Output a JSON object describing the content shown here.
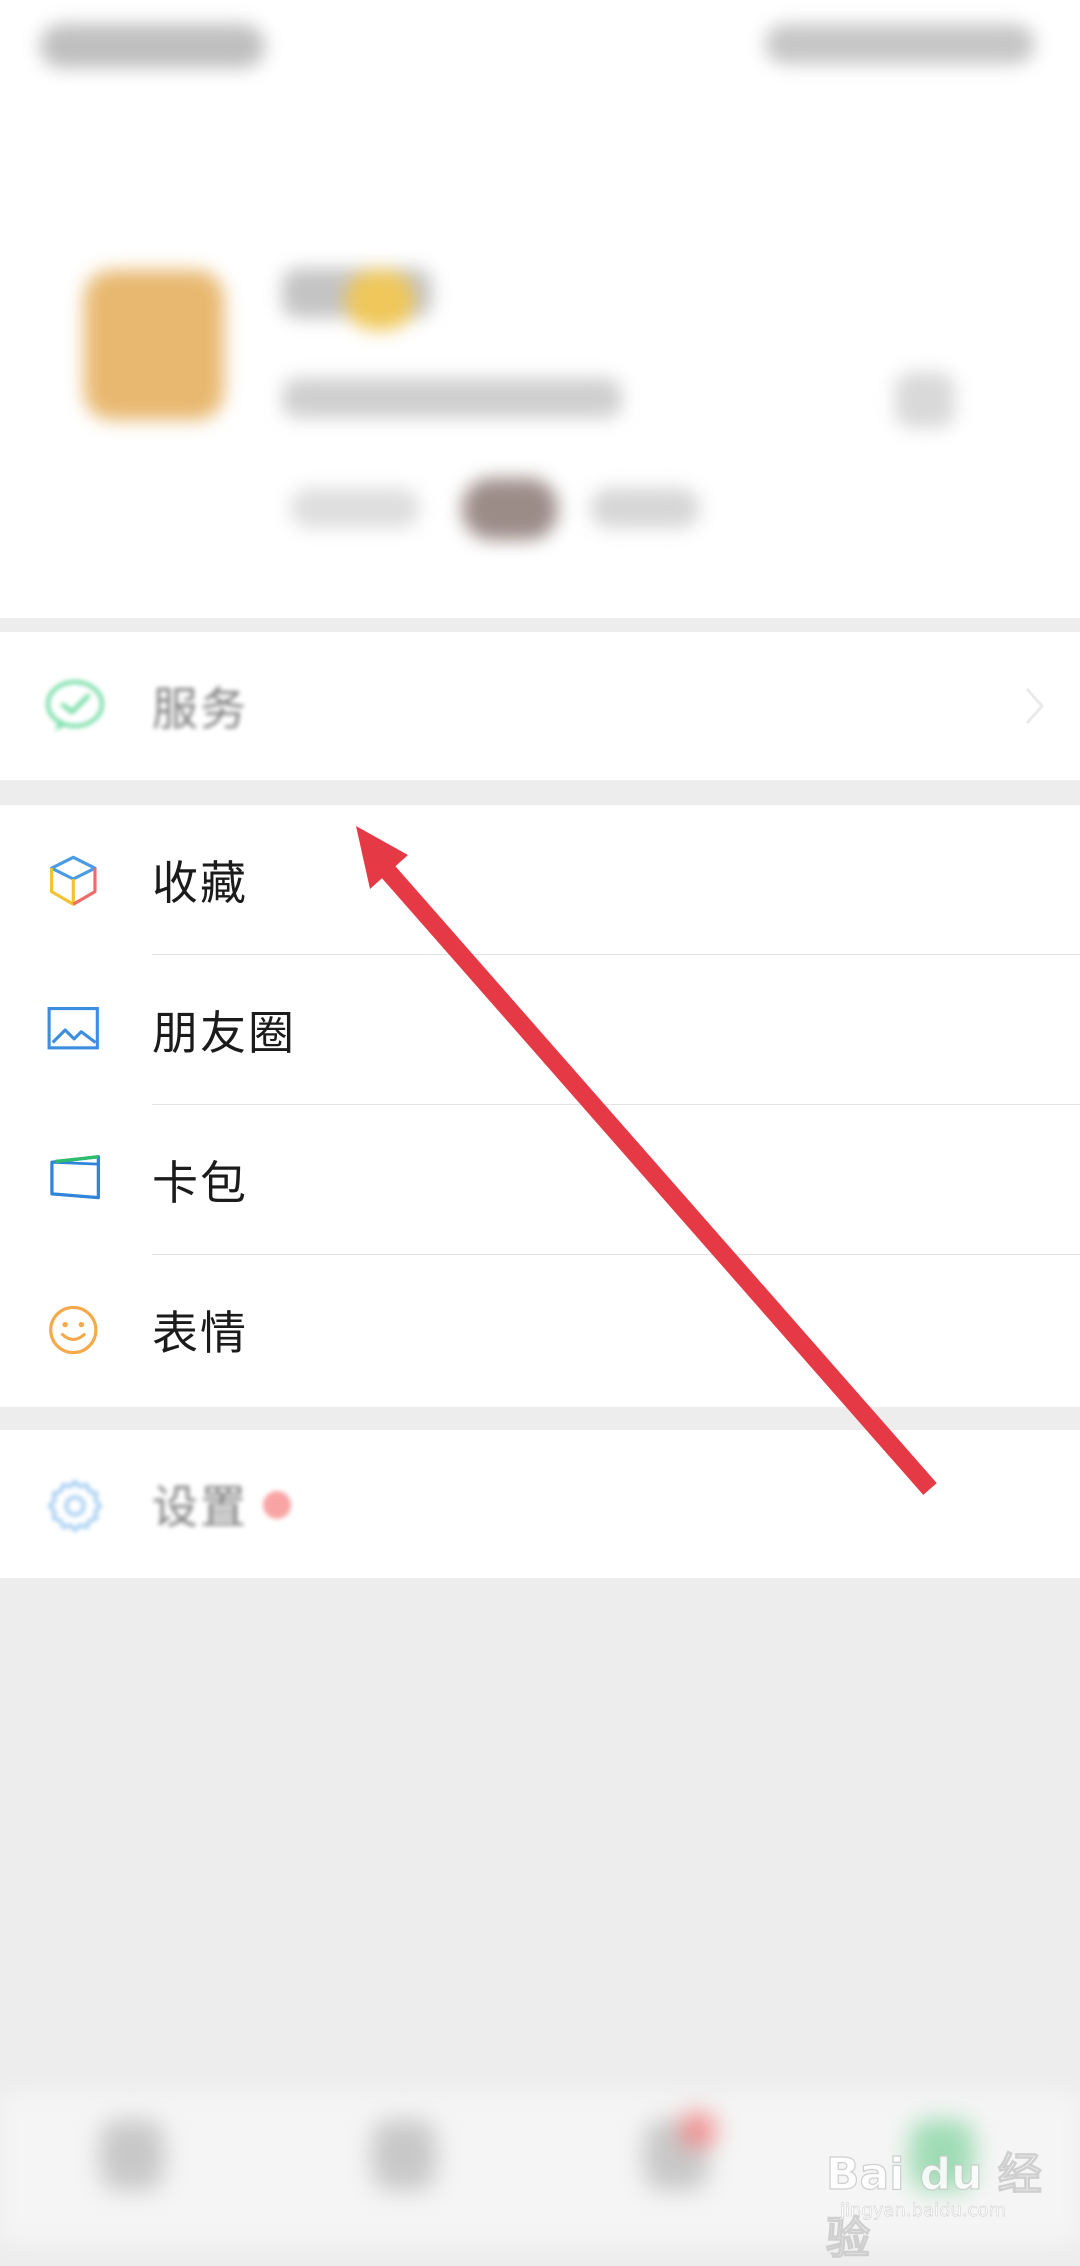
{
  "menu": {
    "services_label": "服务",
    "favorites_label": "收藏",
    "moments_label": "朋友圈",
    "cards_label": "卡包",
    "stickers_label": "表情",
    "settings_label": "设置"
  },
  "watermark": {
    "logo_text": "Bai du 经验",
    "url": "jingyan.baidu.com"
  },
  "colors": {
    "background": "#ededed",
    "card": "#ffffff",
    "arrow": "#e63946",
    "badge": "#f35b5b",
    "wechat_green": "#07c160"
  }
}
